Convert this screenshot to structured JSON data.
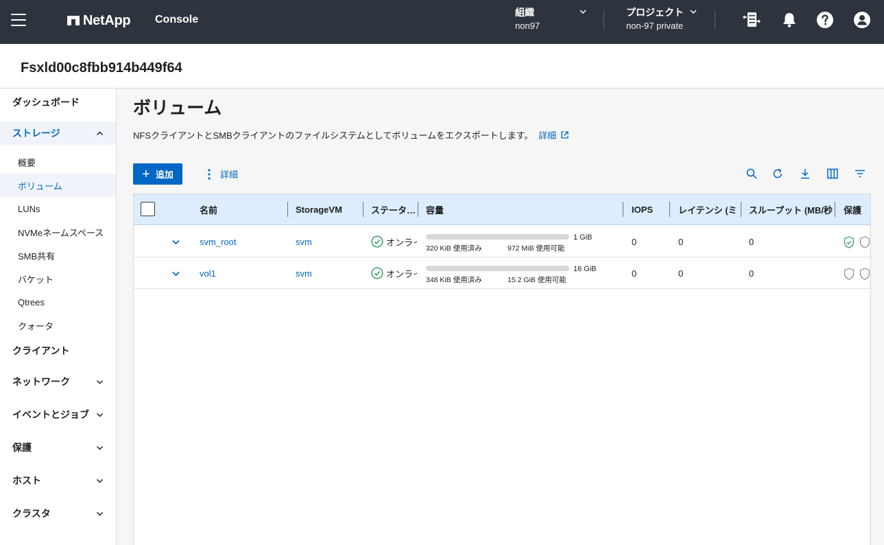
{
  "topbar": {
    "brand": "NetApp",
    "console": "Console",
    "org": {
      "label": "組織",
      "value": "non97"
    },
    "project": {
      "label": "プロジェクト",
      "value": "non-97 private"
    },
    "icons": [
      "menu-icon",
      "connector-icon",
      "bell-icon",
      "help-icon",
      "user-icon"
    ]
  },
  "page": {
    "title": "Fsxld00c8fbb914b449f64"
  },
  "sidebar": {
    "items": [
      {
        "label": "ダッシュボード",
        "level": "top"
      },
      {
        "label": "ストレージ",
        "level": "top",
        "expanded": true
      },
      {
        "label": "概要",
        "level": "sub"
      },
      {
        "label": "ボリューム",
        "level": "sub",
        "selected": true
      },
      {
        "label": "LUNs",
        "level": "sub"
      },
      {
        "label": "NVMeネームスペース",
        "level": "sub"
      },
      {
        "label": "SMB共有",
        "level": "sub"
      },
      {
        "label": "バケット",
        "level": "sub"
      },
      {
        "label": "Qtrees",
        "level": "sub"
      },
      {
        "label": "クォータ",
        "level": "sub"
      },
      {
        "label": "クライアント",
        "level": "top"
      },
      {
        "label": "ネットワーク",
        "level": "top"
      },
      {
        "label": "イベントとジョブ",
        "level": "top"
      },
      {
        "label": "保護",
        "level": "top"
      },
      {
        "label": "ホスト",
        "level": "top"
      },
      {
        "label": "クラスタ",
        "level": "top"
      }
    ]
  },
  "main": {
    "heading": "ボリューム",
    "description": "NFSクライアントとSMBクライアントのファイルシステムとしてボリュームをエクスポートします。",
    "learn_more": "詳細",
    "add_label": "追加",
    "more_label": "詳細",
    "toolbar_icons": [
      "search-icon",
      "refresh-icon",
      "download-icon",
      "columns-icon",
      "filter-icon"
    ]
  },
  "table": {
    "columns": [
      "名前",
      "StorageVM",
      "ステータ…",
      "容量",
      "IOPS",
      "レイテンシ (ミ",
      "スループット (MB/秒",
      "保護"
    ],
    "rows": [
      {
        "name": "svm_root",
        "svm": "svm",
        "status": "オンライ",
        "capacity_total": "1 GiB",
        "used": "320 KiB 使用済み",
        "available": "972 MiB 使用可能",
        "iops": "0",
        "latency": "0",
        "throughput": "0",
        "protection": [
          "shield-check-icon",
          "shield-icon"
        ]
      },
      {
        "name": "vol1",
        "svm": "svm",
        "status": "オンライ",
        "capacity_total": "16 GiB",
        "used": "348 KiB 使用済み",
        "available": "15.2 GiB 使用可能",
        "iops": "0",
        "latency": "0",
        "throughput": "0",
        "protection": [
          "shield-icon",
          "shield-icon"
        ]
      }
    ]
  },
  "colors": {
    "topbar": "#2e343d",
    "accent": "#0067c5",
    "header_row": "#ddedfd",
    "ok_green": "#2e9a5d"
  }
}
